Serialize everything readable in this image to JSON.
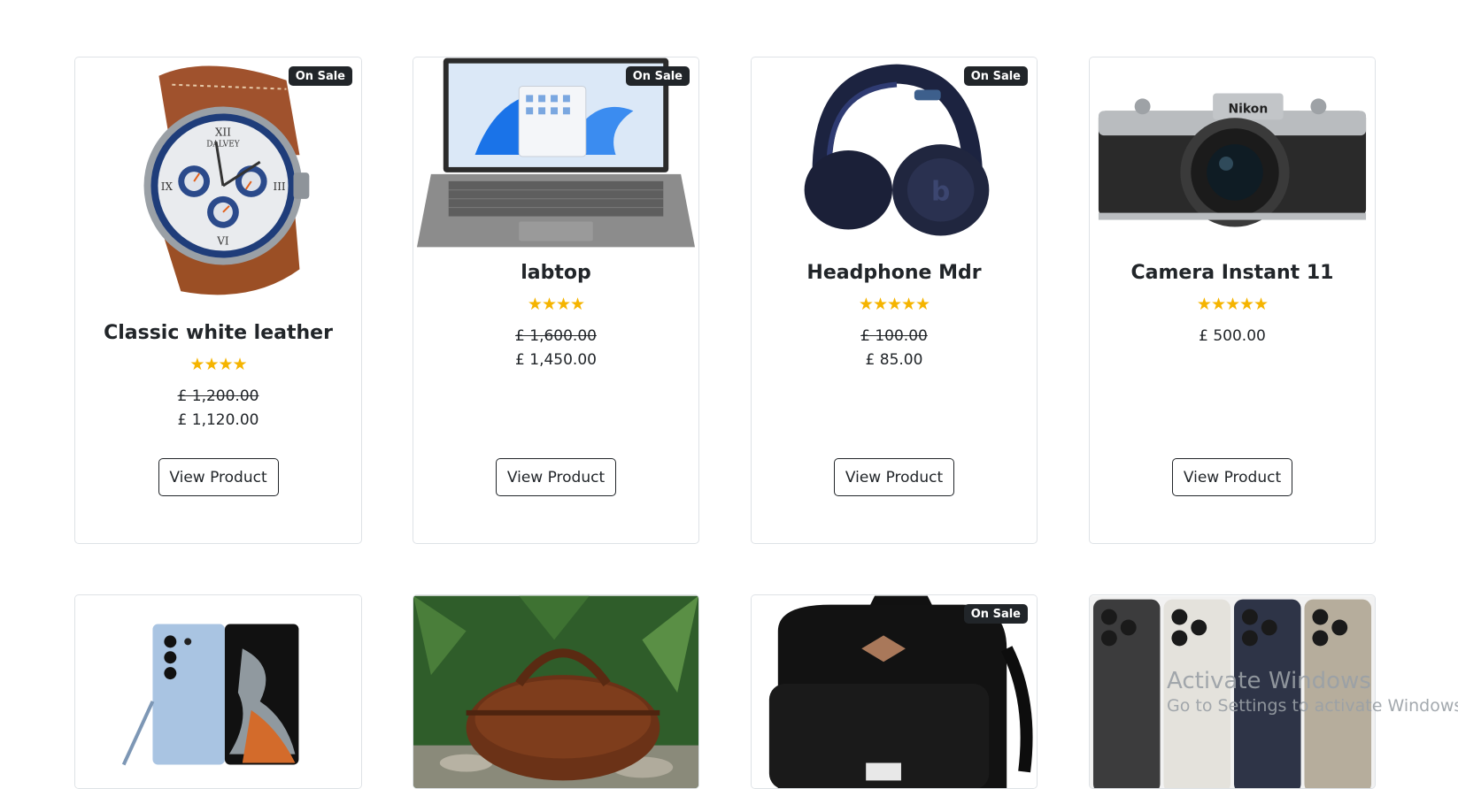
{
  "products": [
    {
      "title": "Classic white leather",
      "badge": "On Sale",
      "rating": 4,
      "stars": "★★★★",
      "old_price": "£ 1,200.00",
      "price": "£ 1,120.00",
      "button": "View Product",
      "image_icon": "watch-image"
    },
    {
      "title": "labtop",
      "badge": "On Sale",
      "rating": 4,
      "stars": "★★★★",
      "old_price": "£ 1,600.00",
      "price": "£ 1,450.00",
      "button": "View Product",
      "image_icon": "laptop-image"
    },
    {
      "title": "Headphone Mdr",
      "badge": "On Sale",
      "rating": 5,
      "stars": "★★★★★",
      "old_price": "£ 100.00",
      "price": "£ 85.00",
      "button": "View Product",
      "image_icon": "headphones-image"
    },
    {
      "title": "Camera Instant 11",
      "rating": 5,
      "stars": "★★★★★",
      "price": "£ 500.00",
      "button": "View Product",
      "image_icon": "camera-image"
    },
    {
      "image_icon": "smartphone-image"
    },
    {
      "image_icon": "duffel-bag-image"
    },
    {
      "badge": "On Sale",
      "image_icon": "backpack-image"
    },
    {
      "image_icon": "iphones-image"
    }
  ],
  "watermark": {
    "line1": "Activate Windows",
    "line2": "Go to Settings to activate Windows."
  },
  "colors": {
    "star": "#f5b400",
    "badge_bg": "#212529",
    "border": "#dee2e6"
  }
}
